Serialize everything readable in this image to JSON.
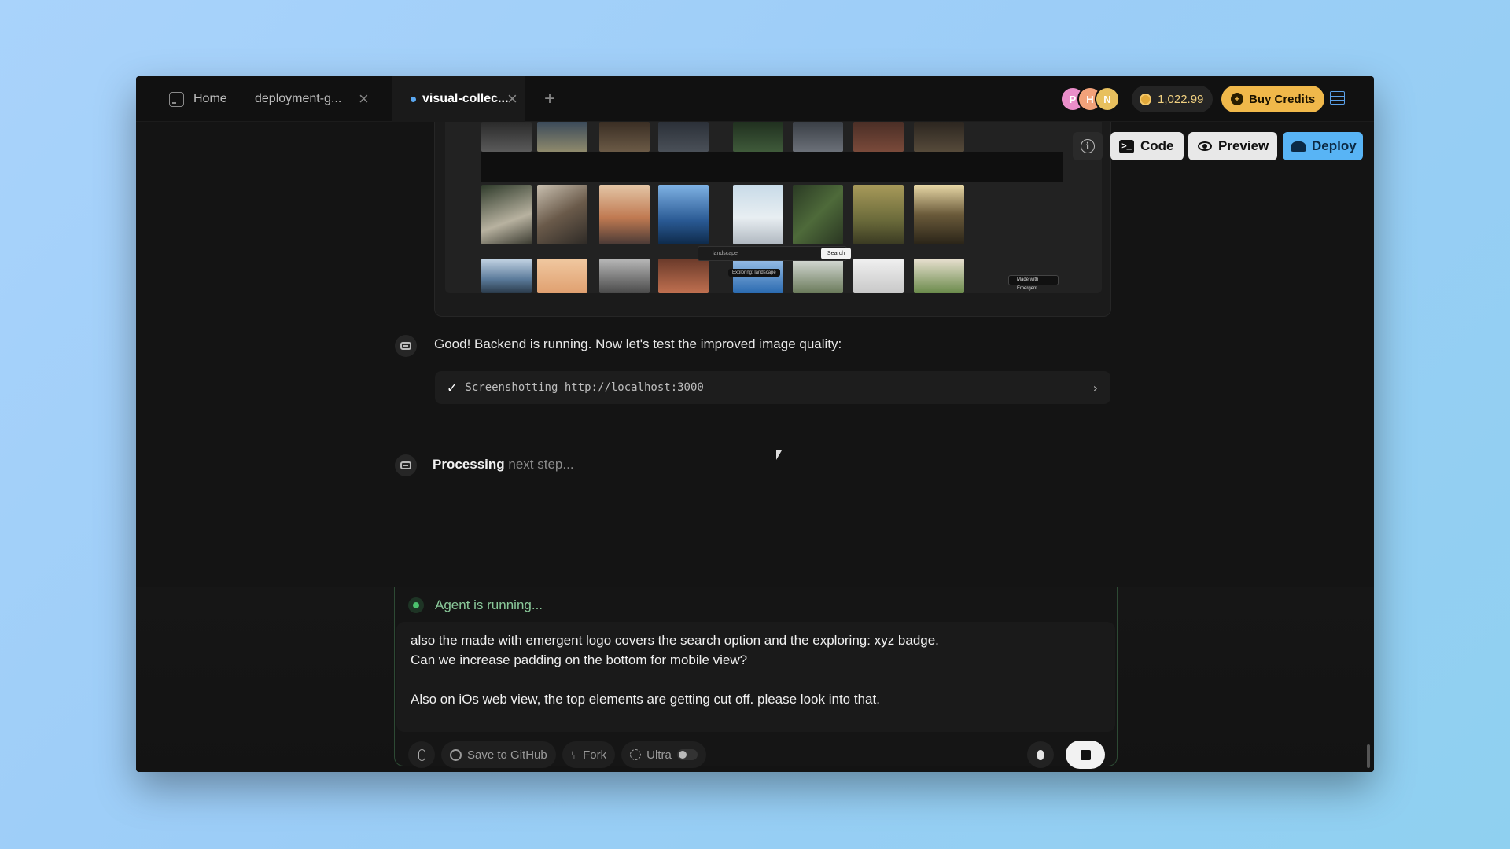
{
  "tabs": {
    "home_label": "Home",
    "deployment_label": "deployment-g...",
    "active_label": "visual-collec..."
  },
  "topbar": {
    "avatars": [
      "P",
      "H",
      "N"
    ],
    "credits": "1,022.99",
    "buy_credits_label": "Buy Credits"
  },
  "toolbar": {
    "code_label": "Code",
    "preview_label": "Preview",
    "deploy_label": "Deploy"
  },
  "preview_image": {
    "search_placeholder": "landscape",
    "search_button": "Search",
    "exploring_badge": "Exploring: landscape",
    "made_with_badge": "Made with Emergent"
  },
  "chat": {
    "message": "Good! Backend is running. Now let's test the improved image quality:",
    "tool_call": "Screenshotting http://localhost:3000",
    "processing_bold": "Processing",
    "processing_rest": " next step..."
  },
  "composer": {
    "status": "Agent is running...",
    "text": "also the made with emergent logo covers the search option and the exploring: xyz badge.\nCan we increase padding on the bottom for mobile view?\n\nAlso on iOs web view, the top elements are getting cut off. please look into that.",
    "save_github_label": "Save to GitHub",
    "fork_label": "Fork",
    "ultra_label": "Ultra"
  },
  "colors": {
    "accent_blue": "#58b4f5",
    "buy_credits": "#f0b84a",
    "running_green": "#4cc26e"
  }
}
